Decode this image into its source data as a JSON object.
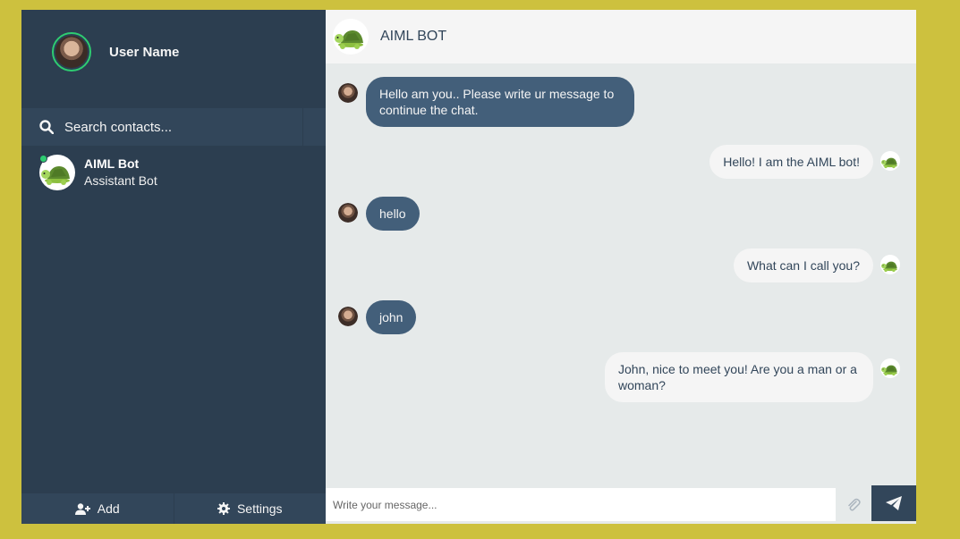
{
  "profile": {
    "name": "User Name"
  },
  "search": {
    "placeholder": "Search contacts..."
  },
  "contacts": [
    {
      "name": "AIML Bot",
      "preview": "Assistant Bot",
      "status": "online"
    }
  ],
  "bottom_bar": {
    "add_label": "Add",
    "settings_label": "Settings"
  },
  "chat": {
    "title": "AIML BOT",
    "messages": [
      {
        "from": "user",
        "text": "Hello am you.. Please write ur message to continue the chat."
      },
      {
        "from": "bot",
        "text": "Hello! I am the AIML bot!"
      },
      {
        "from": "user",
        "text": "hello"
      },
      {
        "from": "bot",
        "text": "What can I call you?"
      },
      {
        "from": "user",
        "text": "john"
      },
      {
        "from": "bot",
        "text": "John, nice to meet you! Are you a man or a woman?"
      }
    ],
    "compose_placeholder": "Write your message..."
  },
  "colors": {
    "page_bg": "#cdc13e",
    "sidebar_bg": "#2c3e50",
    "sent_bubble": "#435f7a",
    "reply_bubble": "#f5f5f5",
    "online": "#2ecc71"
  },
  "icons": {
    "bot_avatar": "turtle-icon",
    "search": "search-icon",
    "add": "user-plus-icon",
    "settings": "gear-icon",
    "attach": "paperclip-icon",
    "send": "paper-plane-icon"
  }
}
